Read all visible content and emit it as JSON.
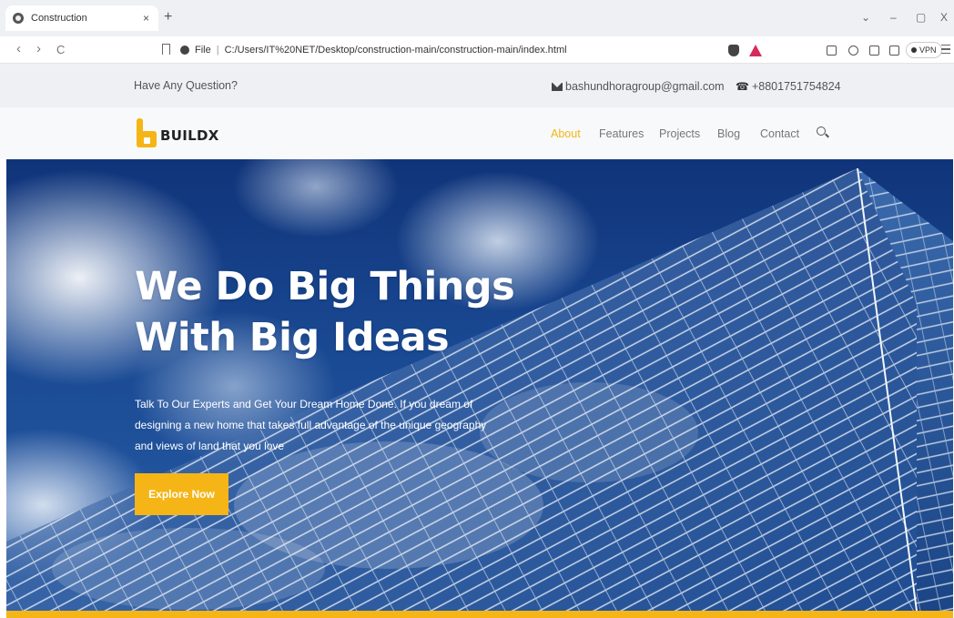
{
  "browser": {
    "tab_title": "Construction",
    "tab_close": "×",
    "new_tab": "+",
    "back": "‹",
    "forward": "›",
    "reload": "C",
    "url_scheme_label": "File",
    "url_separator": "|",
    "url": "C:/Users/IT%20NET/Desktop/construction-main/construction-main/index.html",
    "vpn_label": "VPN",
    "window_minimize": "–",
    "window_restore": "▢",
    "window_close": "X",
    "tab_list": "⌄"
  },
  "topbar": {
    "question": "Have Any Question?",
    "email": "bashundhoragroup@gmail.com",
    "phone": "+8801751754824"
  },
  "nav": {
    "logo_text": "BUILDX",
    "links": [
      {
        "label": "About",
        "active": true
      },
      {
        "label": "Features",
        "active": false
      },
      {
        "label": "Projects",
        "active": false
      },
      {
        "label": "Blog",
        "active": false
      },
      {
        "label": "Contact",
        "active": false
      }
    ]
  },
  "hero": {
    "title_line1": "We Do Big Things",
    "title_line2": "With Big Ideas",
    "description": "Talk To Our Experts and Get Your Dream Home Done. If you dream of designing a new home that takes full advantage of the unique geography and views of land that you love",
    "cta_label": "Explore Now"
  },
  "colors": {
    "accent": "#f5b516",
    "sky": "#1a4a94",
    "topbar_bg": "#eef0f4"
  }
}
